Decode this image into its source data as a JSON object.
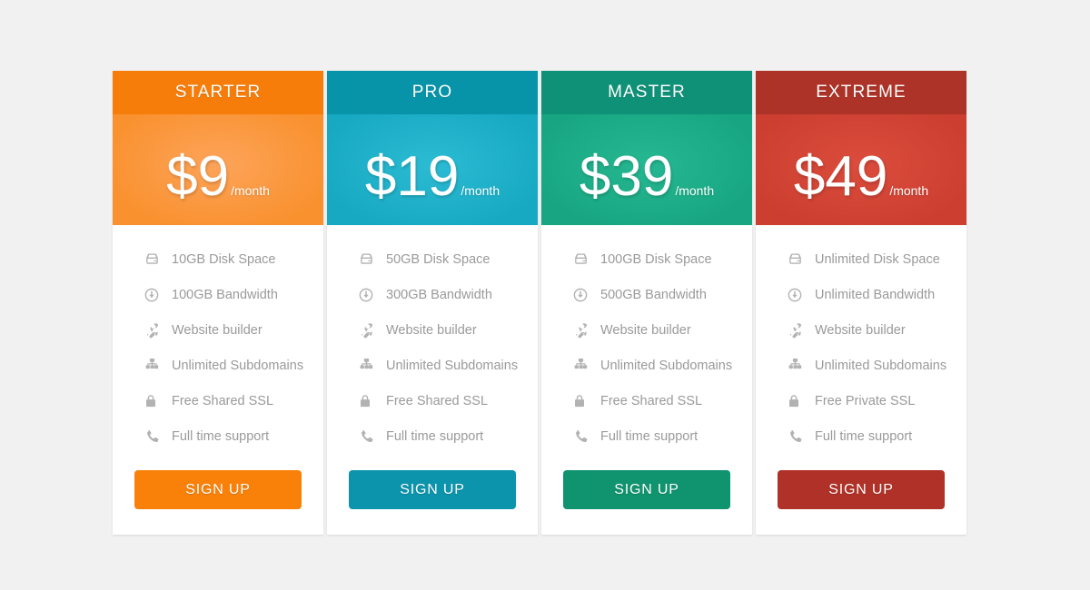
{
  "page": {
    "background": "#f1f1f1"
  },
  "icons": {
    "disk": "hdd-icon",
    "bandwidth": "download-circle-icon",
    "builder": "wrench-icon",
    "subdomains": "sitemap-icon",
    "ssl": "lock-icon",
    "support": "phone-icon"
  },
  "signup_label": "SIGN UP",
  "plans": [
    {
      "name": "STARTER",
      "currency": "$",
      "amount": "9",
      "period": "/month",
      "header_color": "#f77d0b",
      "price_color_center": "#fda košík",
      "price_color_a": "#fda45a",
      "price_color_b": "#f9912f",
      "button_color": "#f98109",
      "features": [
        {
          "icon": "hdd-icon",
          "label": "10GB Disk Space"
        },
        {
          "icon": "download-circle-icon",
          "label": "100GB Bandwidth"
        },
        {
          "icon": "wrench-icon",
          "label": "Website builder"
        },
        {
          "icon": "sitemap-icon",
          "label": "Unlimited Subdomains"
        },
        {
          "icon": "lock-icon",
          "label": "Free Shared SSL"
        },
        {
          "icon": "phone-icon",
          "label": "Full time support"
        }
      ]
    },
    {
      "name": "PRO",
      "currency": "$",
      "amount": "19",
      "period": "/month",
      "header_color": "#0794a8",
      "price_color_a": "#2bbcd4",
      "price_color_b": "#18a9c2",
      "button_color": "#0b94ac",
      "features": [
        {
          "icon": "hdd-icon",
          "label": "50GB Disk Space"
        },
        {
          "icon": "download-circle-icon",
          "label": "300GB Bandwidth"
        },
        {
          "icon": "wrench-icon",
          "label": "Website builder"
        },
        {
          "icon": "sitemap-icon",
          "label": "Unlimited Subdomains"
        },
        {
          "icon": "lock-icon",
          "label": "Free Shared SSL"
        },
        {
          "icon": "phone-icon",
          "label": "Full time support"
        }
      ]
    },
    {
      "name": "MASTER",
      "currency": "$",
      "amount": "39",
      "period": "/month",
      "header_color": "#0f9178",
      "price_color_a": "#26b892",
      "price_color_b": "#17a681",
      "button_color": "#10936f",
      "features": [
        {
          "icon": "hdd-icon",
          "label": "100GB Disk Space"
        },
        {
          "icon": "download-circle-icon",
          "label": "500GB Bandwidth"
        },
        {
          "icon": "wrench-icon",
          "label": "Website builder"
        },
        {
          "icon": "sitemap-icon",
          "label": "Unlimited Subdomains"
        },
        {
          "icon": "lock-icon",
          "label": "Free Shared SSL"
        },
        {
          "icon": "phone-icon",
          "label": "Full time support"
        }
      ]
    },
    {
      "name": "EXTREME",
      "currency": "$",
      "amount": "49",
      "period": "/month",
      "header_color": "#ad3227",
      "price_color_a": "#db4c3c",
      "price_color_b": "#cc3f30",
      "button_color": "#b03127",
      "features": [
        {
          "icon": "hdd-icon",
          "label": "Unlimited Disk Space"
        },
        {
          "icon": "download-circle-icon",
          "label": "Unlimited Bandwidth"
        },
        {
          "icon": "wrench-icon",
          "label": "Website builder"
        },
        {
          "icon": "sitemap-icon",
          "label": "Unlimited Subdomains"
        },
        {
          "icon": "lock-icon",
          "label": "Free Private SSL"
        },
        {
          "icon": "phone-icon",
          "label": "Full time support"
        }
      ]
    }
  ]
}
